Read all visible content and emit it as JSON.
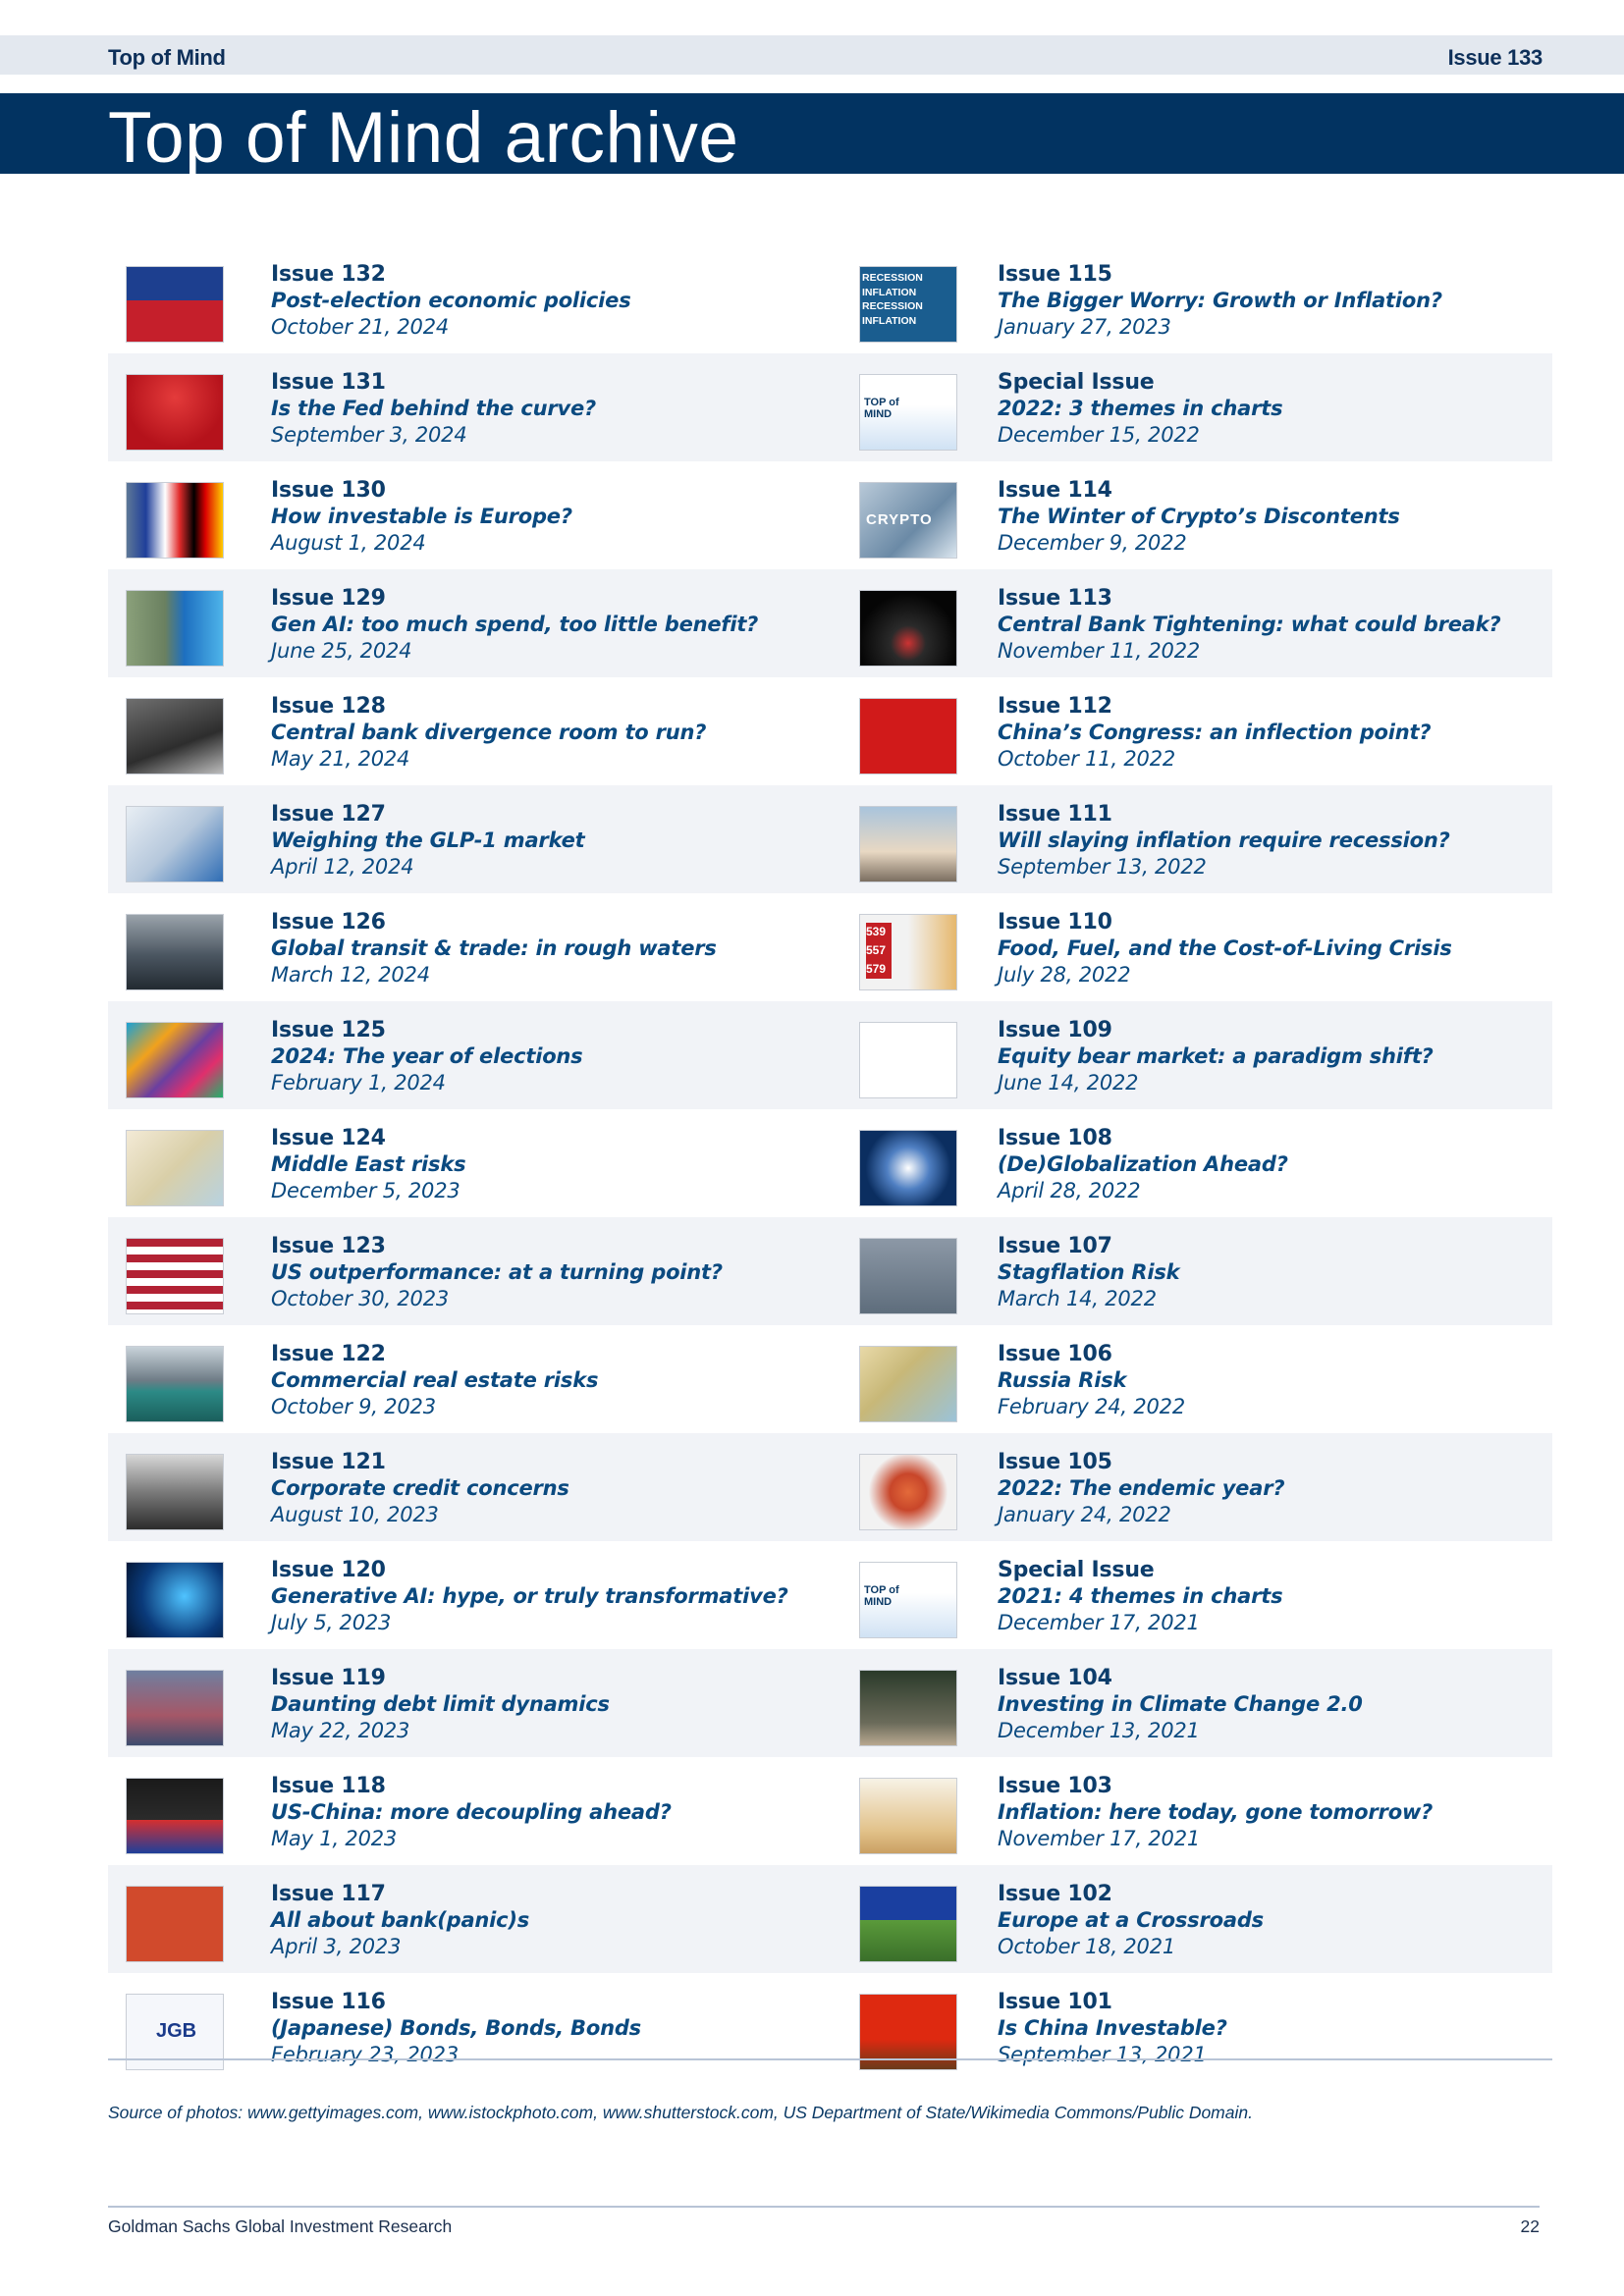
{
  "header": {
    "section": "Top of Mind",
    "issue": "Issue 133",
    "title": "Top of Mind archive"
  },
  "left_column": [
    {
      "issue": "Issue 132",
      "topic": "Post-election economic policies",
      "date": "October 21, 2024",
      "icon": "donkey-elephant-photo"
    },
    {
      "issue": "Issue 131",
      "topic": "Is the Fed behind the curve?",
      "date": "September 3, 2024",
      "icon": "red-curve-photo"
    },
    {
      "issue": "Issue 130",
      "topic": "How investable is Europe?",
      "date": "August 1, 2024",
      "icon": "european-flags-photo"
    },
    {
      "issue": "Issue 129",
      "topic": "Gen AI: too much spend, too little benefit?",
      "date": "June 25, 2024",
      "icon": "ai-dollar-photo"
    },
    {
      "issue": "Issue 128",
      "topic": "Central bank divergence room to run?",
      "date": "May 21, 2024",
      "icon": "diverging-road-photo"
    },
    {
      "issue": "Issue 127",
      "topic": "Weighing the GLP-1 market",
      "date": "April 12, 2024",
      "icon": "injection-pen-photo"
    },
    {
      "issue": "Issue 126",
      "topic": "Global transit & trade: in rough waters",
      "date": "March 12, 2024",
      "icon": "ship-rough-sea-photo"
    },
    {
      "issue": "Issue 125",
      "topic": "2024: The year of elections",
      "date": "February 1, 2024",
      "icon": "ballot-box-photo"
    },
    {
      "issue": "Issue 124",
      "topic": "Middle East risks",
      "date": "December 5, 2023",
      "icon": "israel-map-photo"
    },
    {
      "issue": "Issue 123",
      "topic": "US outperformance: at a turning point?",
      "date": "October 30, 2023",
      "icon": "us-flag-photo"
    },
    {
      "issue": "Issue 122",
      "topic": "Commercial real estate risks",
      "date": "October 9, 2023",
      "icon": "flooded-buildings-photo"
    },
    {
      "issue": "Issue 121",
      "topic": "Corporate credit concerns",
      "date": "August 10, 2023",
      "icon": "storm-wave-photo"
    },
    {
      "issue": "Issue 120",
      "topic": "Generative AI: hype, or truly transformative?",
      "date": "July 5, 2023",
      "icon": "ai-head-photo"
    },
    {
      "issue": "Issue 119",
      "topic": "Daunting debt limit dynamics",
      "date": "May 22, 2023",
      "icon": "capitol-photo"
    },
    {
      "issue": "Issue 118",
      "topic": "US-China: more decoupling ahead?",
      "date": "May 1, 2023",
      "icon": "chess-pieces-photo"
    },
    {
      "issue": "Issue 117",
      "topic": "All about bank(panic)s",
      "date": "April 3, 2023",
      "icon": "bank-panic-icon"
    },
    {
      "issue": "Issue 116",
      "topic": "(Japanese) Bonds, Bonds, Bonds",
      "date": "February 23, 2023",
      "icon": "jgb-word-cloud"
    }
  ],
  "right_column": [
    {
      "issue": "Issue 115",
      "topic": "The Bigger Worry: Growth or Inflation?",
      "date": "January 27, 2023",
      "icon": "recession-inflation-words"
    },
    {
      "issue": "Special Issue",
      "topic": "2022: 3 themes in charts",
      "date": "December 15, 2022",
      "icon": "top-of-mind-cover"
    },
    {
      "issue": "Issue 114",
      "topic": "The Winter of Crypto’s Discontents",
      "date": "December 9, 2022",
      "icon": "crypto-ice-photo"
    },
    {
      "issue": "Issue 113",
      "topic": "Central Bank Tightening: what could break?",
      "date": "November 11, 2022",
      "icon": "pipe-photo"
    },
    {
      "issue": "Issue 112",
      "topic": "China’s Congress: an inflection point?",
      "date": "October 11, 2022",
      "icon": "xi-photo"
    },
    {
      "issue": "Issue 111",
      "topic": "Will slaying inflation require recession?",
      "date": "September 13, 2022",
      "icon": "signpost-photo"
    },
    {
      "issue": "Issue 110",
      "topic": "Food, Fuel, and the Cost-of-Living Crisis",
      "date": "July 28, 2022",
      "icon": "fuel-prices-photo"
    },
    {
      "issue": "Issue 109",
      "topic": "Equity bear market: a paradigm shift?",
      "date": "June 14, 2022",
      "icon": "paradigm-shift-words"
    },
    {
      "issue": "Issue 108",
      "topic": "(De)Globalization Ahead?",
      "date": "April 28, 2022",
      "icon": "globe-photo"
    },
    {
      "issue": "Issue 107",
      "topic": "Stagflation Risk",
      "date": "March 14, 2022",
      "icon": "stagflation-text-photo"
    },
    {
      "issue": "Issue 106",
      "topic": "Russia Risk",
      "date": "February 24, 2022",
      "icon": "russia-map-photo"
    },
    {
      "issue": "Issue 105",
      "topic": "2022: The endemic year?",
      "date": "January 24, 2022",
      "icon": "virus-photo"
    },
    {
      "issue": "Special Issue",
      "topic": "2021: 4 themes in charts",
      "date": "December 17, 2021",
      "icon": "top-of-mind-cover"
    },
    {
      "issue": "Issue 104",
      "topic": "Investing in Climate Change 2.0",
      "date": "December 13, 2021",
      "icon": "plant-coins-photo"
    },
    {
      "issue": "Issue 103",
      "topic": "Inflation: here today, gone tomorrow?",
      "date": "November 17, 2021",
      "icon": "coins-plants-photo"
    },
    {
      "issue": "Issue 102",
      "topic": "Europe at a Crossroads",
      "date": "October 18, 2021",
      "icon": "eu-road-photo"
    },
    {
      "issue": "Issue 101",
      "topic": "Is China Investable?",
      "date": "September 13, 2021",
      "icon": "china-gavel-photo"
    }
  ],
  "thumb_labels": {
    "recession": "RECESSION\nINFLATION\nRECESSION\nINFLATION",
    "crypto": "CRYPTO",
    "jgb": "JGB",
    "top_mind": "TOP of MIND",
    "prices": "539 557 579"
  },
  "source_note": "Source of photos: www.gettyimages.com, www.istockphoto.com, www.shutterstock.com, US Department of State/Wikimedia Commons/Public Domain.",
  "footer": {
    "left": "Goldman Sachs Global Investment Research",
    "page": "22"
  }
}
